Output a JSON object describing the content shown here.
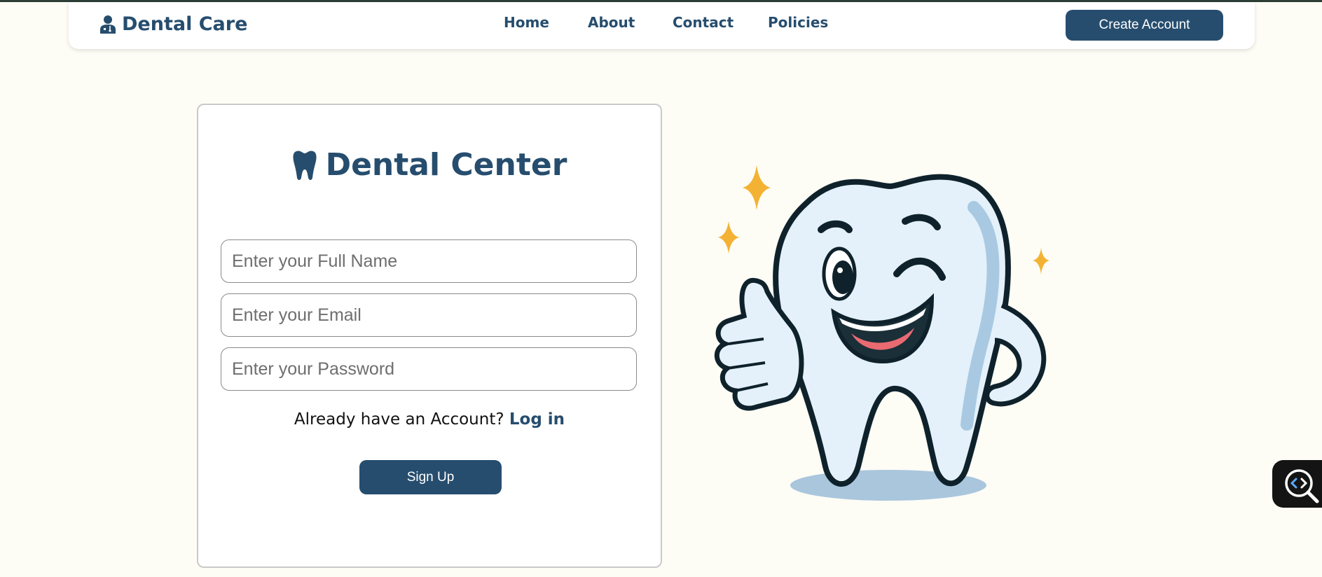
{
  "nav": {
    "brand": "Dental Care",
    "links": [
      "Home",
      "About",
      "Contact",
      "Policies"
    ],
    "cta_label": "Create Account"
  },
  "form": {
    "title": "Dental Center",
    "fields": [
      {
        "placeholder": "Enter your Full Name",
        "value": ""
      },
      {
        "placeholder": "Enter your Email",
        "value": ""
      },
      {
        "placeholder": "Enter your Password",
        "value": ""
      }
    ],
    "login_prompt": "Already have an Account?",
    "login_link": "Log in",
    "submit_label": "Sign Up"
  },
  "icons": {
    "brand": "user-doctor-icon",
    "title": "tooth-icon",
    "mascot": "tooth-mascot-illustration",
    "inspector": "code-search-icon"
  },
  "colors": {
    "brand": "#264d6e",
    "page_background": "#fdfcf5",
    "card_background": "#ffffff"
  }
}
